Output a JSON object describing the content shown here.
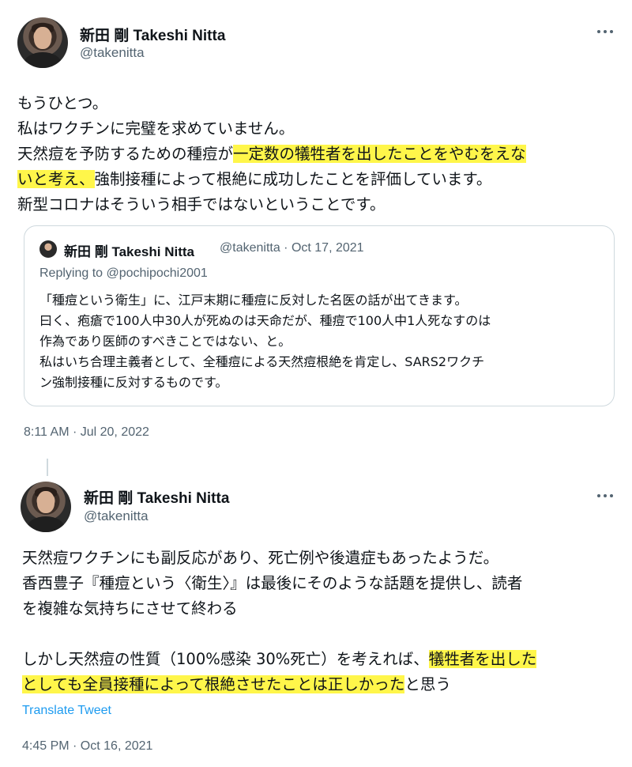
{
  "tweets": [
    {
      "display_name": "新田 剛 Takeshi Nitta",
      "handle": "@takenitta",
      "timestamp": "8:11 AM · Jul 20, 2022",
      "body_lines": [
        {
          "parts": [
            {
              "text": "もうひとつ。",
              "hl": false
            }
          ]
        },
        {
          "parts": [
            {
              "text": "私はワクチンに完璧を求めていません。",
              "hl": false
            }
          ]
        },
        {
          "parts": [
            {
              "text": "天然痘を予防するための種痘が",
              "hl": false
            },
            {
              "text": "一定数の犠牲者を出したことをやむをえな",
              "hl": true
            }
          ]
        },
        {
          "parts": [
            {
              "text": "いと考え、",
              "hl": true
            },
            {
              "text": "強制接種によって根絶に成功したことを評価しています。",
              "hl": false
            }
          ]
        },
        {
          "parts": [
            {
              "text": "新型コロナはそういう相手ではないということです。",
              "hl": false
            }
          ]
        }
      ],
      "quoted": {
        "display_name": "新田 剛 Takeshi Nitta",
        "meta": "@takenitta · Oct 17, 2021",
        "replying_to": "Replying to @pochipochi2001",
        "lines": [
          "「種痘という衛生」に、江戸末期に種痘に反対した名医の話が出てきます。",
          "曰く、疱瘡で100人中30人が死ぬのは天命だが、種痘で100人中1人死なすのは",
          "作為であり医師のすべきことではない、と。",
          "私はいち合理主義者として、全種痘による天然痘根絶を肯定し、SARS2ワクチ",
          "ン強制接種に反対するものです。"
        ]
      }
    },
    {
      "display_name": "新田 剛 Takeshi Nitta",
      "handle": "@takenitta",
      "timestamp": "4:45 PM · Oct 16, 2021",
      "translate": "Translate Tweet",
      "body_lines": [
        {
          "parts": [
            {
              "text": "天然痘ワクチンにも副反応があり、死亡例や後遺症もあったようだ。",
              "hl": false
            }
          ]
        },
        {
          "parts": [
            {
              "text": "香西豊子『種痘という〈衛生〉』は最後にそのような話題を提供し、読者",
              "hl": false
            }
          ]
        },
        {
          "parts": [
            {
              "text": "を複雑な気持ちにさせて終わる",
              "hl": false
            }
          ]
        },
        {
          "parts": [
            {
              "text": "",
              "hl": false
            }
          ]
        },
        {
          "parts": [
            {
              "text": "しかし天然痘の性質（100%感染 30%死亡）を考えれば、",
              "hl": false
            },
            {
              "text": "犠牲者を出した",
              "hl": true
            }
          ]
        },
        {
          "parts": [
            {
              "text": "としても全員接種によって根絶させたことは正しかった",
              "hl": true
            },
            {
              "text": "と思う",
              "hl": false
            }
          ]
        }
      ]
    }
  ]
}
